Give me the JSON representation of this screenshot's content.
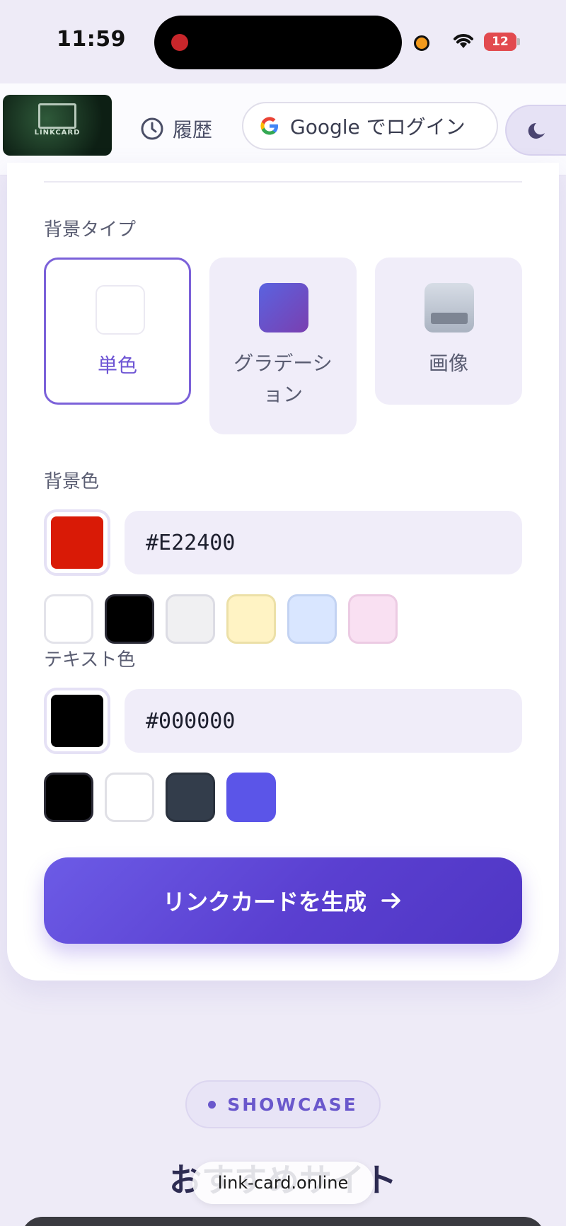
{
  "status_bar": {
    "time": "11:59",
    "battery": "12"
  },
  "header": {
    "logo_text": "LINKCARD",
    "history_label": "履歴",
    "login_label": "Google でログイン"
  },
  "form": {
    "background_type_label": "背景タイプ",
    "background_types": [
      {
        "label": "単色",
        "selected": true,
        "swatch": "#ffffff"
      },
      {
        "label": "グラデーション",
        "selected": false,
        "swatch": "gradient-purple"
      },
      {
        "label": "画像",
        "selected": false,
        "swatch": "image-gray"
      }
    ],
    "background_color_label": "背景色",
    "background_color_value": "#E22400",
    "background_presets": [
      "#ffffff",
      "#000000",
      "#eeeeee",
      "#fff3c4",
      "#d9e6ff",
      "#f9e0f2"
    ],
    "text_color_label": "テキスト色",
    "text_color_value": "#000000",
    "text_presets": [
      "#000000",
      "#ffffff",
      "#333d4b",
      "#5b55e8"
    ],
    "generate_label": "リンクカードを生成"
  },
  "showcase": {
    "badge": "SHOWCASE",
    "title": "おすすめサイト",
    "url": "link-card.online"
  },
  "colors": {
    "accent": "#6e55d4",
    "page_bg": "#eeebf7"
  }
}
